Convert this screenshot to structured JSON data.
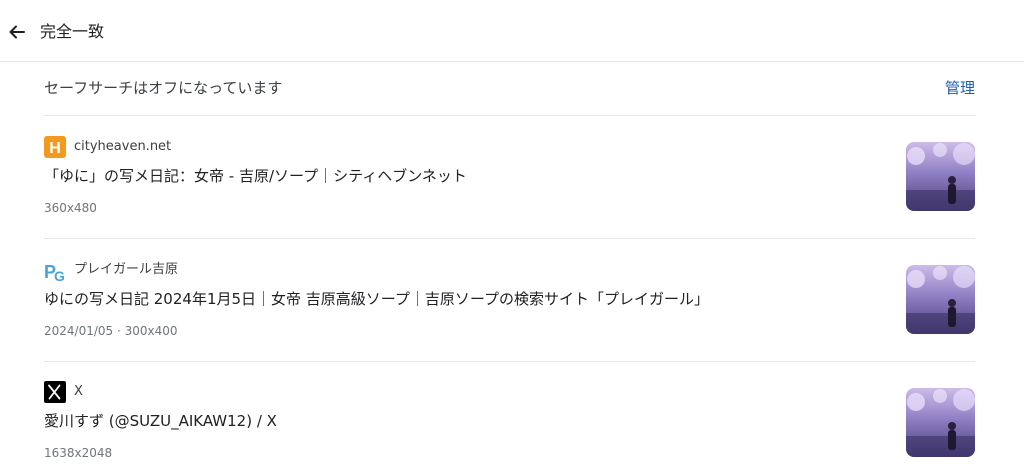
{
  "header": {
    "title": "完全一致",
    "back_icon": "arrow-left-icon"
  },
  "safesearch": {
    "text": "セーフサーチはオフになっています",
    "manage_label": "管理"
  },
  "results": [
    {
      "site": "cityheaven.net",
      "favicon": "cityheaven-h-icon",
      "title": "「ゆに」の写メ日記：女帝 - 吉原/ソープ｜シティヘブンネット",
      "meta": "360x480"
    },
    {
      "site": "プレイガール吉原",
      "favicon": "playgirl-pg-icon",
      "title": "ゆにの写メ日記 2024年1月5日｜女帝 吉原高級ソープ｜吉原ソープの検索サイト「プレイガール」",
      "meta": "2024/01/05 · 300x400"
    },
    {
      "site": "X",
      "favicon": "x-logo-icon",
      "title": "愛川すず (@SUZU_AIKAW12) / X",
      "meta": "1638x2048"
    }
  ],
  "colors": {
    "link": "#1a5fb4",
    "cityheaven_orange": "#f29a1b",
    "playgirl_blue": "#4aa3d8",
    "x_black": "#000000"
  }
}
